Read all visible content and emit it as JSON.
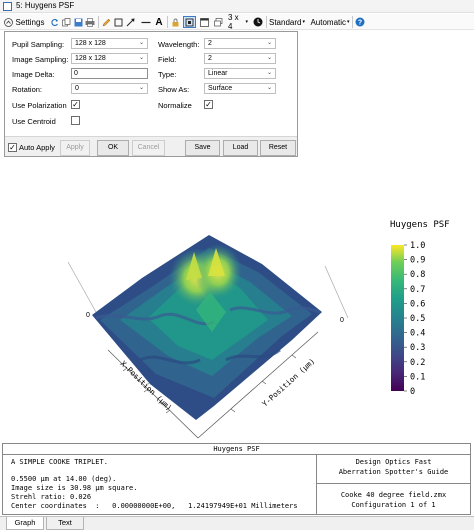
{
  "window": {
    "title": "5: Huygens PSF"
  },
  "toolbar": {
    "settings_label": "Settings",
    "layout_label": "3 x 4",
    "standard_label": "Standard",
    "automatic_label": "Automatic"
  },
  "settings": {
    "pupil_sampling_label": "Pupil Sampling:",
    "pupil_sampling_value": "128 x 128",
    "image_sampling_label": "Image Sampling:",
    "image_sampling_value": "128 x 128",
    "image_delta_label": "Image Delta:",
    "image_delta_value": "0",
    "rotation_label": "Rotation:",
    "rotation_value": "0",
    "use_polarization_label": "Use Polarization",
    "use_polarization_checked": true,
    "use_centroid_label": "Use Centroid",
    "use_centroid_checked": false,
    "wavelength_label": "Wavelength:",
    "wavelength_value": "2",
    "field_label": "Field:",
    "field_value": "2",
    "type_label": "Type:",
    "type_value": "Linear",
    "show_as_label": "Show As:",
    "show_as_value": "Surface",
    "normalize_label": "Normalize",
    "normalize_checked": true
  },
  "buttons": {
    "auto_apply": "Auto Apply",
    "apply": "Apply",
    "ok": "OK",
    "cancel": "Cancel",
    "save": "Save",
    "load": "Load",
    "reset": "Reset"
  },
  "plot": {
    "colorbar_title": "Huygens PSF",
    "colorbar_ticks": [
      "1.0",
      "0.9",
      "0.8",
      "0.7",
      "0.6",
      "0.5",
      "0.4",
      "0.3",
      "0.2",
      "0.1",
      "0"
    ],
    "x_axis_label": "X-Position (µm)",
    "y_axis_label": "Y-Position (µm)",
    "left_corner_label": "0",
    "right_corner_label": "0"
  },
  "text_panel": {
    "title": "Huygens PSF",
    "line1": "A SIMPLE COOKE TRIPLET.",
    "line2": "0.5500 µm at 14.00 (deg).",
    "line3": "Image size is 30.98 µm square.",
    "line4": "Strehl ratio: 0.026",
    "line5": "Center coordinates  :   0.00000000E+00,   1.24197949E+01 Millimeters",
    "right_top1": "Design Optics Fast",
    "right_top2": "Aberration Spotter's Guide",
    "right_bottom1": "Cooke 40 degree field.zmx",
    "right_bottom2": "Configuration 1 of 1"
  },
  "tabs": {
    "graph": "Graph",
    "text": "Text"
  },
  "colors": {
    "accent": "#2b79d0",
    "viridis_low": "#440154",
    "viridis_high": "#fde725"
  }
}
